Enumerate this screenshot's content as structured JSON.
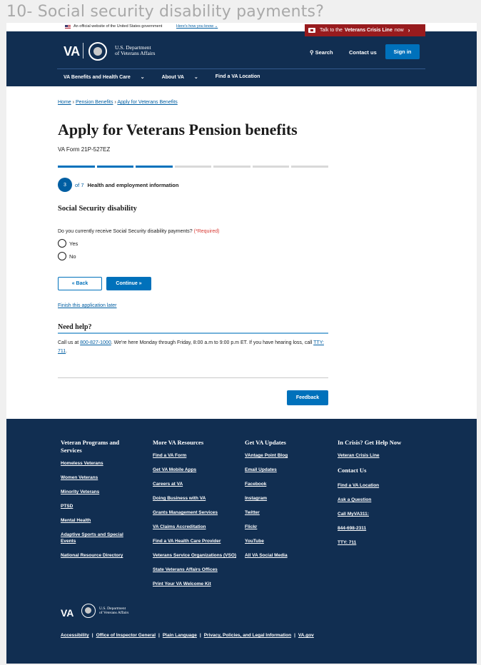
{
  "frame_title": "10- Social security disability payments?",
  "gov_banner": {
    "text": "An official website of the United States government",
    "link": "Here's how you know",
    "chevron": "⌄"
  },
  "crisis_line": {
    "prefix": "Talk to the",
    "bold": "Veterans Crisis Line",
    "suffix": "now",
    "chevron": "›"
  },
  "header": {
    "logo": "VA",
    "dept_line1": "U.S. Department",
    "dept_line2": "of Veterans Affairs",
    "search": "Search",
    "contact": "Contact us",
    "signin": "Sign in",
    "nav": [
      "VA Benefits and Health Care",
      "About VA",
      "Find a VA Location"
    ]
  },
  "breadcrumb": {
    "home": "Home",
    "sep1": "›",
    "pension": "Pension Benefits",
    "sep2": "›",
    "current": "Apply for Veterans Benefits"
  },
  "main": {
    "title": "Apply for Veterans Pension benefits",
    "form_number": "VA Form 21P-527EZ",
    "progress": {
      "current": 3,
      "total": 7
    },
    "step_number": "3",
    "step_of": "of 7",
    "step_title": "Health and employment information",
    "section_title": "Social Security disability",
    "question": "Do you currently receive Social Security disability payments?",
    "required": "(*Required)",
    "options": [
      "Yes",
      "No"
    ],
    "back": "« Back",
    "continue": "Continue »",
    "finish_later": "Finish this application later",
    "need_help": "Need help?",
    "help_before": "Call us at ",
    "help_phone": "800-827-1000",
    "help_middle": ". We're here Monday through Friday, 8:00 a.m to 9:00 p.m ET. If you have hearing loss, call ",
    "help_tty": "TTY: 711",
    "help_end": ".",
    "feedback": "Feedback"
  },
  "footer": {
    "col1": {
      "title": "Veteran Programs and Services",
      "links": [
        "Homeless Veterans",
        "Women Veterans",
        "Minority Veterans",
        "PTSD",
        "Mental Health",
        "Adaptive Sports and Special Events",
        "National Resource Directory"
      ]
    },
    "col2": {
      "title": "More VA Resources",
      "links": [
        "Find a VA Form",
        "Get VA Mobile Apps",
        "Careers at VA",
        "Doing Business with VA",
        "Grants Management Services",
        "VA Claims Accreditation",
        "Find a VA Health Care Provider",
        "Veterans Service Organizations (VSO)",
        "State Veterans Affairs Offices",
        "Print Your VA Welcome Kit"
      ]
    },
    "col3": {
      "title": "Get VA Updates",
      "links": [
        "VAntage Point Blog",
        "Email Updates",
        "Facebook",
        "Instagram",
        "Twitter",
        "Flickr",
        "YouTube",
        "All VA Social Media"
      ]
    },
    "col4": {
      "title": "In Crisis? Get Help Now",
      "crisis_link": "Veteran Crisis Line",
      "contact_title": "Contact Us",
      "links": [
        "Find a VA Location",
        "Ask a Question",
        "Call MyVA311:",
        "844-698-2311",
        "TTY: 711"
      ]
    },
    "logo": "VA",
    "dept_line1": "U.S. Department",
    "dept_line2": "of Veterans Affairs",
    "bottom_links": [
      "Accessibility",
      "Office of Inspector General",
      "Plain Language",
      "Privacy, Policies, and Legal Information",
      "VA.gov"
    ],
    "separator": "|"
  },
  "colors": {
    "navy": "#112e51",
    "primary": "#0071bb",
    "link": "#005ea2",
    "crisis": "#981b1e",
    "required": "#d83933"
  },
  "icons": [
    "flag-icon",
    "crisis-line-icon",
    "va-seal-icon",
    "search-icon",
    "chevron-down-icon",
    "radio-icon"
  ]
}
